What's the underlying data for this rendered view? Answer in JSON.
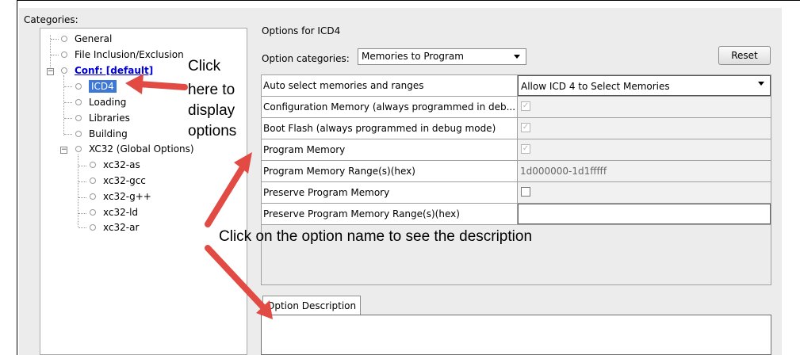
{
  "categories_label": "Categories:",
  "tree": {
    "general": "General",
    "file_inclusion": "File Inclusion/Exclusion",
    "conf": "Conf: [default]",
    "icd4": "ICD4",
    "loading": "Loading",
    "libraries": "Libraries",
    "building": "Building",
    "xc32_global": "XC32 (Global Options)",
    "xc32_as": "xc32-as",
    "xc32_gcc": "xc32-gcc",
    "xc32_gpp": "xc32-g++",
    "xc32_ld": "xc32-ld",
    "xc32_ar": "xc32-ar"
  },
  "annotations": {
    "line1": "Click",
    "line2": "here to",
    "line3": "display",
    "line4": "options",
    "bottom": "Click on the option name to see the description",
    "arrow_color": "#e24b43"
  },
  "options_title": "Options for ICD4",
  "option_categories_label": "Option categories:",
  "option_categories_value": "Memories to Program",
  "reset_label": "Reset",
  "rows": [
    {
      "name": "Auto select memories and ranges",
      "value": "Allow ICD 4 to Select Memories"
    },
    {
      "name": "Configuration Memory (always programmed in deb...",
      "value": "✓"
    },
    {
      "name": "Boot Flash (always programmed in debug mode)",
      "value": "✓"
    },
    {
      "name": "Program Memory",
      "value": "✓"
    },
    {
      "name": "Program Memory Range(s)(hex)",
      "value": "1d000000-1d1fffff"
    },
    {
      "name": "Preserve Program Memory",
      "value": ""
    },
    {
      "name": "Preserve Program Memory Range(s)(hex)",
      "value": ""
    }
  ],
  "option_description_tab": "Option Description",
  "colors": {
    "selection": "#3d78d8",
    "link": "#0000d8"
  }
}
